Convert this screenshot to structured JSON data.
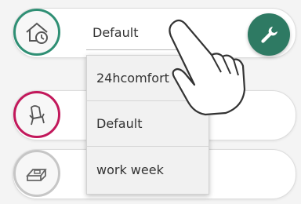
{
  "program_select": {
    "selected": "Default",
    "options": [
      "24hcomfort",
      "Default",
      "work week"
    ]
  },
  "icons": {
    "row1": "home-clock-icon",
    "row2": "armchair-icon",
    "row3": "bed-icon",
    "settings": "wrench-icon",
    "pointer": "hand-pointer-icon"
  },
  "colors": {
    "accent_green": "#2e7a63",
    "accent_pink": "#c2185b"
  }
}
